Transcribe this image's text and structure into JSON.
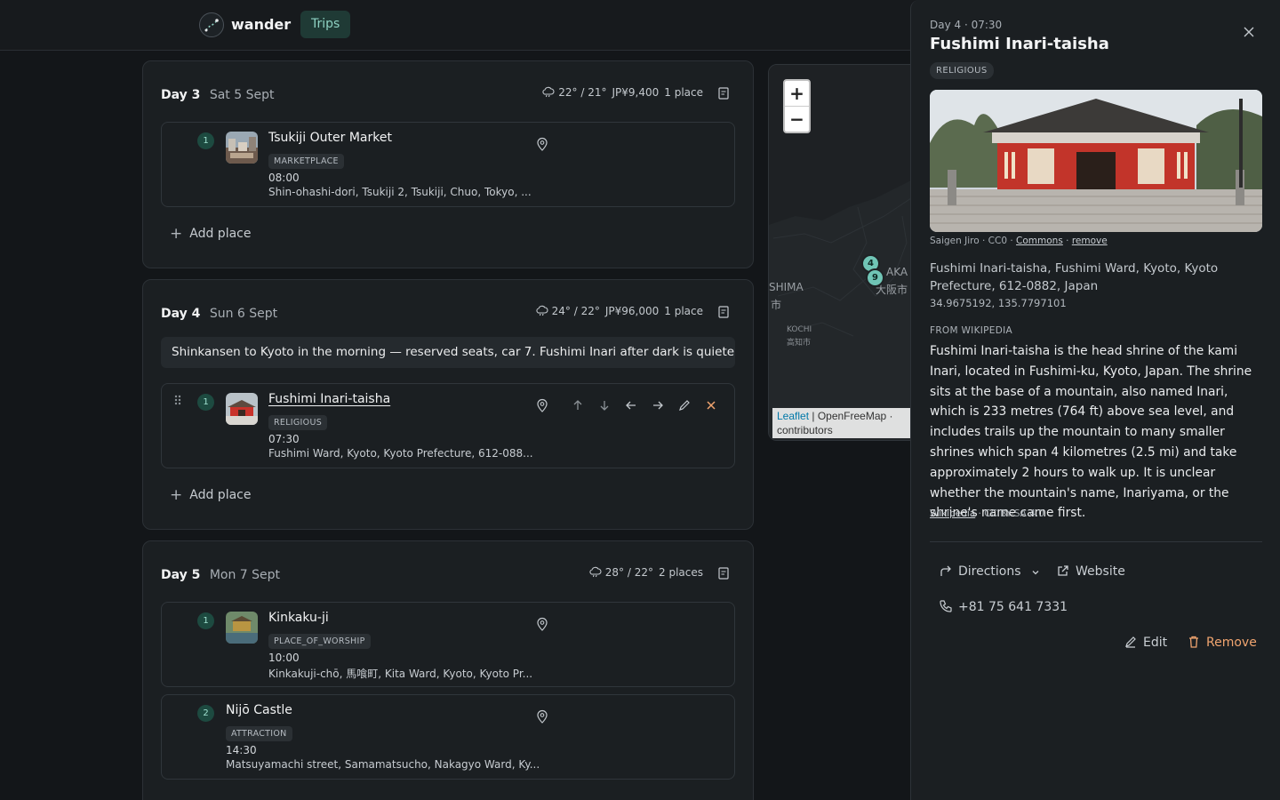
{
  "app": {
    "brand": "wander",
    "nav_trips": "Trips"
  },
  "days": [
    {
      "label": "Day 3",
      "date": "Sat 5 Sept",
      "weather": "22° / 21°",
      "cost": "JP¥9,400",
      "count": "1 place",
      "places": [
        {
          "index": "1",
          "name": "Tsukiji Outer Market",
          "category": "MARKETPLACE",
          "time": "08:00",
          "address": "Shin-ohashi-dori, Tsukiji 2, Tsukiji, Chuo, Tokyo, ..."
        }
      ],
      "add_label": "Add place"
    },
    {
      "label": "Day 4",
      "date": "Sun 6 Sept",
      "weather": "24° / 22°",
      "cost": "JP¥96,000",
      "count": "1 place",
      "note": "Shinkansen to Kyoto in the morning — reserved seats, car 7. Fushimi Inari after dark is quieter.",
      "places": [
        {
          "index": "1",
          "name": "Fushimi Inari-taisha",
          "category": "RELIGIOUS",
          "time": "07:30",
          "address": "Fushimi Ward, Kyoto, Kyoto Prefecture, 612-088..."
        }
      ],
      "add_label": "Add place"
    },
    {
      "label": "Day 5",
      "date": "Mon 7 Sept",
      "weather": "28° / 22°",
      "count": "2 places",
      "places": [
        {
          "index": "1",
          "name": "Kinkaku-ji",
          "category": "PLACE_OF_WORSHIP",
          "time": "10:00",
          "address": "Kinkakuji-chō, 馬喰町, Kita Ward, Kyoto, Kyoto Pr..."
        },
        {
          "index": "2",
          "name": "Nijō Castle",
          "category": "ATTRACTION",
          "time": "14:30",
          "address": "Matsuyamachi street, Samamatsucho, Nakagyo Ward, Ky..."
        }
      ]
    }
  ],
  "map": {
    "zoom_in": "+",
    "zoom_out": "−",
    "labels": {
      "shima": "SHIMA",
      "shima_kanji": "市",
      "aka": "AKA",
      "osaka_kanji": "大阪市",
      "kochi": "KOCHI",
      "kochi_kanji": "高知市"
    },
    "markers": [
      "4",
      "9"
    ],
    "attribution": {
      "leaflet": "Leaflet",
      "rest": " | OpenFreeMap · contributors"
    }
  },
  "panel": {
    "kicker": "Day 4 · 07:30",
    "title": "Fushimi Inari-taisha",
    "category": "RELIGIOUS",
    "photo_credit": {
      "author": "Saigen Jiro · CC0 · ",
      "commons": "Commons",
      "sep": " · ",
      "remove": "remove"
    },
    "address": "Fushimi Inari-taisha, Fushimi Ward, Kyoto, Kyoto Prefecture, 612-0882, Japan",
    "coords": "34.9675192, 135.7797101",
    "source_heading": "FROM WIKIPEDIA",
    "summary": "Fushimi Inari-taisha is the head shrine of the kami Inari, located in Fushimi-ku, Kyoto, Japan. The shrine sits at the base of a mountain, also named Inari, which is 233 metres (764 ft) above sea level, and includes trails up the mountain to many smaller shrines which span 4 kilometres (2.5 mi) and take approximately 2 hours to walk up. It is unclear whether the mountain's name, Inariyama, or the shrine's name came first.",
    "license": {
      "link": "Wikipedia",
      "rest": " · CC BY-SA 4.0"
    },
    "directions": "Directions",
    "website": "Website",
    "phone": "+81 75 641 7331",
    "edit": "Edit",
    "remove": "Remove"
  },
  "colors": {
    "accent": "#70c5b6",
    "danger": "#f0a46f",
    "background": "#131619"
  },
  "icons": [
    "logo-icon",
    "cloud-icon",
    "notes-icon",
    "pin-icon",
    "drag-icon",
    "arrow-up-icon",
    "arrow-down-icon",
    "arrow-left-icon",
    "arrow-right-icon",
    "pencil-icon",
    "close-icon",
    "plus-icon",
    "directions-icon",
    "chevron-down-icon",
    "external-link-icon",
    "phone-icon",
    "trash-icon"
  ]
}
